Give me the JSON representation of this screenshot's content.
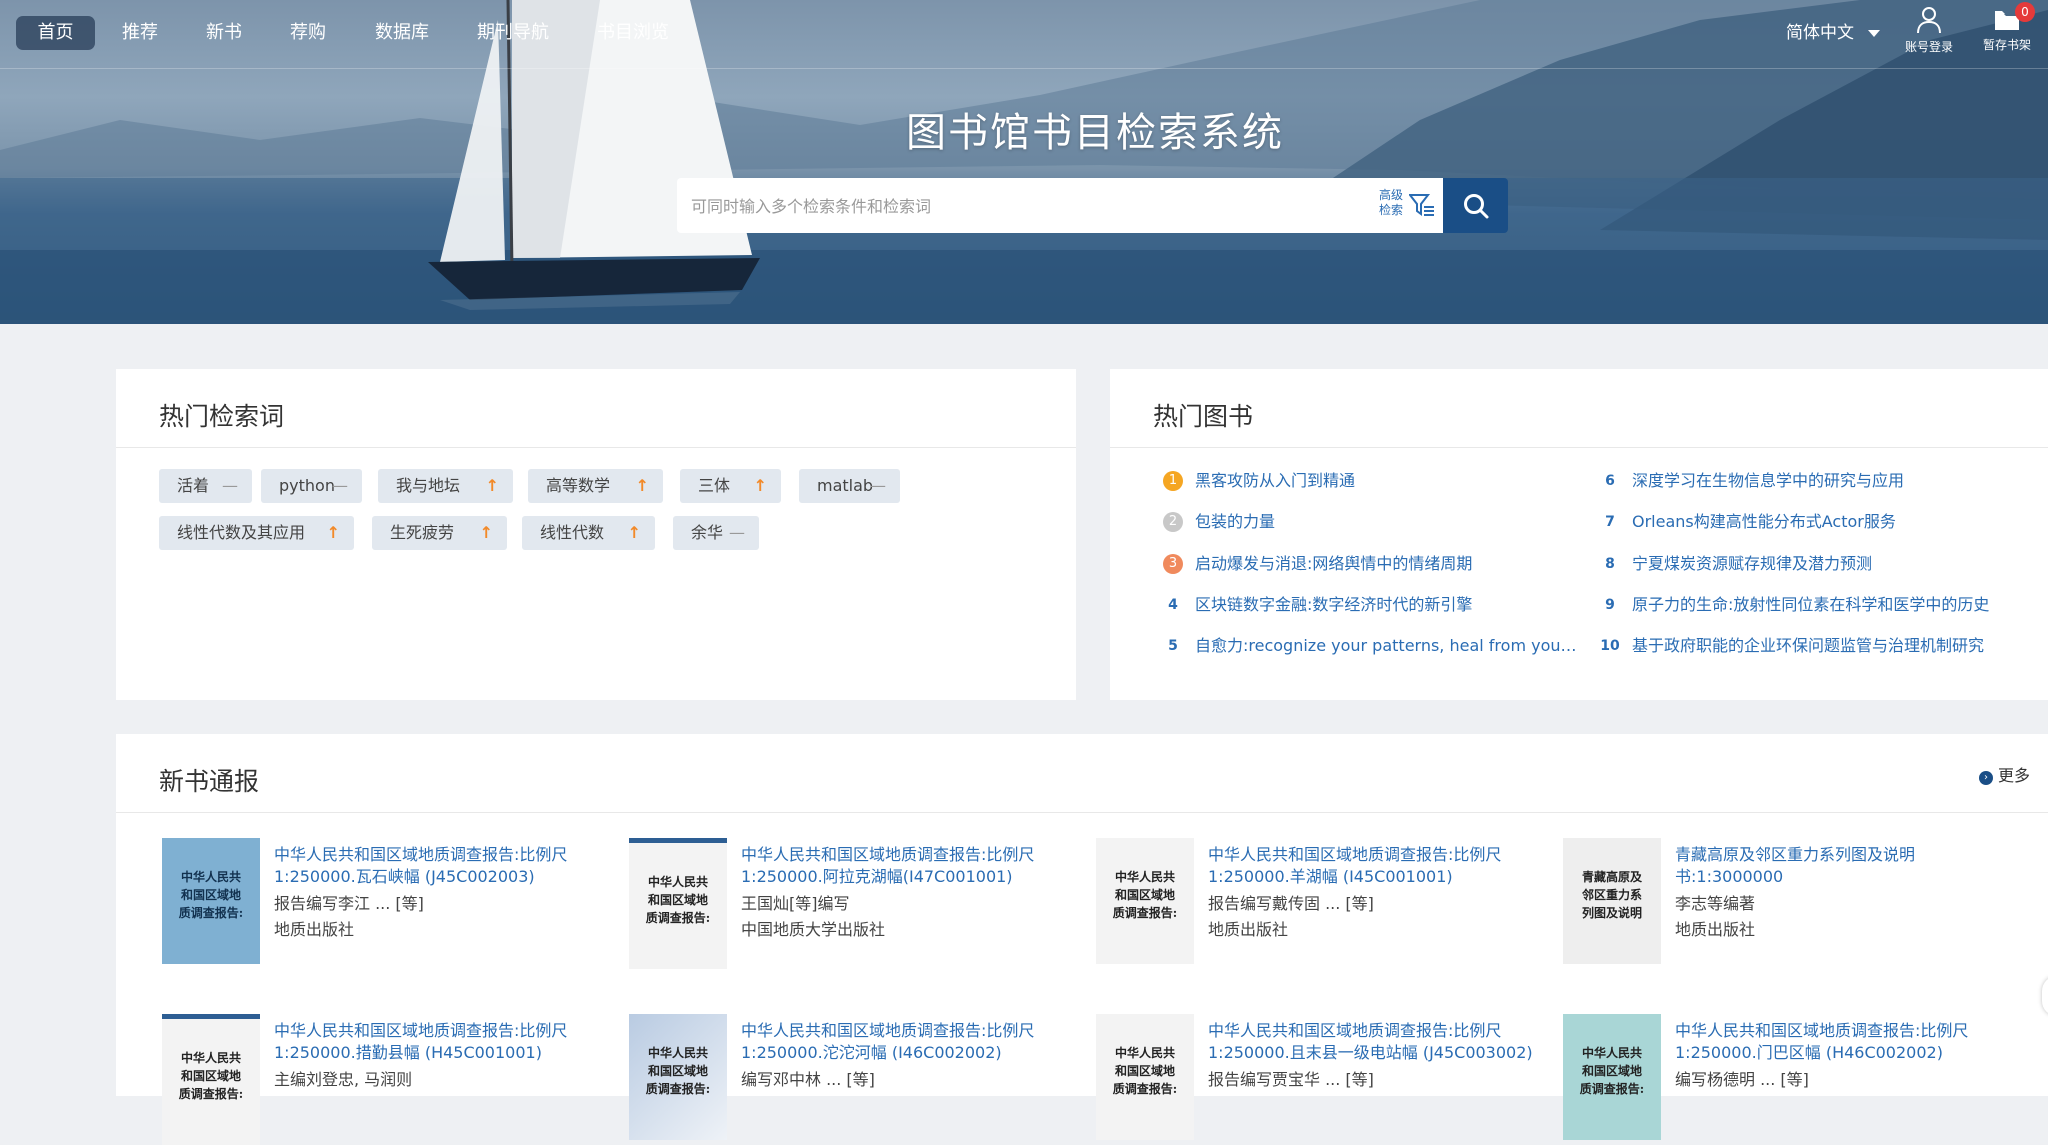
{
  "nav": {
    "items": [
      "首页",
      "推荐",
      "新书",
      "荐购",
      "数据库",
      "期刊导航",
      "书目浏览"
    ],
    "language": "简体中文",
    "account_label": "账号登录",
    "cart_label": "暂存书架",
    "cart_count": "0"
  },
  "hero": {
    "title": "图书馆书目检索系统",
    "search_placeholder": "可同时输入多个检索条件和检索词",
    "advanced_search_label": "高级检索"
  },
  "hot_terms": {
    "title": "热门检索词",
    "tags": [
      {
        "label": "活着",
        "trend": "flat"
      },
      {
        "label": "python",
        "trend": "flat"
      },
      {
        "label": "我与地坛",
        "trend": "up"
      },
      {
        "label": "高等数学",
        "trend": "up"
      },
      {
        "label": "三体",
        "trend": "up"
      },
      {
        "label": "matlab",
        "trend": "flat"
      },
      {
        "label": "线性代数及其应用",
        "trend": "up"
      },
      {
        "label": "生死疲劳",
        "trend": "up"
      },
      {
        "label": "线性代数",
        "trend": "up"
      },
      {
        "label": "余华",
        "trend": "flat"
      }
    ]
  },
  "hot_books": {
    "title": "热门图书",
    "items": [
      {
        "rank": "1",
        "title": "黑客攻防从入门到精通"
      },
      {
        "rank": "2",
        "title": "包装的力量"
      },
      {
        "rank": "3",
        "title": "启动爆发与消退:网络舆情中的情绪周期"
      },
      {
        "rank": "4",
        "title": "区块链数字金融:数字经济时代的新引擎"
      },
      {
        "rank": "5",
        "title": "自愈力:recognize your patterns, heal from your past, a..."
      },
      {
        "rank": "6",
        "title": "深度学习在生物信息学中的研究与应用"
      },
      {
        "rank": "7",
        "title": "Orleans构建高性能分布式Actor服务"
      },
      {
        "rank": "8",
        "title": "宁夏煤炭资源赋存规律及潜力预测"
      },
      {
        "rank": "9",
        "title": "原子力的生命:放射性同位素在科学和医学中的历史"
      },
      {
        "rank": "10",
        "title": "基于政府职能的企业环保问题监管与治理机制研究"
      }
    ]
  },
  "new_books": {
    "title": "新书通报",
    "more_label": "更多",
    "items": [
      {
        "title": "中华人民共和国区域地质调查报告:比例尺1:250000.瓦石峡幅 (J45C002003)",
        "author": "报告编写李江 ... [等]",
        "publisher": "地质出版社",
        "cover_text": "中华人民共\n和国区域地\n质调查报告:",
        "cover_color": "#7fb0d2"
      },
      {
        "title": "中华人民共和国区域地质调查报告:比例尺1:250000.阿拉克湖幅(I47C001001)",
        "author": "王国灿[等]编写",
        "publisher": "中国地质大学出版社",
        "cover_text": "中华人民共\n和国区域地\n质调查报告:",
        "cover_color": "#f2f2f2"
      },
      {
        "title": "中华人民共和国区域地质调查报告:比例尺1:250000.羊湖幅 (I45C001001)",
        "author": "报告编写戴传固 ... [等]",
        "publisher": "地质出版社",
        "cover_text": "中华人民共\n和国区域地\n质调查报告:",
        "cover_color": "#f4f4f4"
      },
      {
        "title": "青藏高原及邻区重力系列图及说明书:1:3000000",
        "author": "李志等编著",
        "publisher": "地质出版社",
        "cover_text": "青藏高原及\n邻区重力系\n列图及说明",
        "cover_color": "#eeeeee"
      },
      {
        "title": "中华人民共和国区域地质调查报告:比例尺1:250000.措勤县幅 (H45C001001)",
        "author": "主编刘登忠, 马润则",
        "publisher": "",
        "cover_text": "中华人民共\n和国区域地\n质调查报告:",
        "cover_color": "#f4f4f4"
      },
      {
        "title": "中华人民共和国区域地质调查报告:比例尺1:250000.沱沱河幅 (I46C002002)",
        "author": "编写邓中林 ... [等]",
        "publisher": "",
        "cover_text": "中华人民共\n和国区域地\n质调查报告:",
        "cover_color": "#dfe6f0"
      },
      {
        "title": "中华人民共和国区域地质调查报告:比例尺1:250000.且末县一级电站幅 (J45C003002)",
        "author": "报告编写贾宝华 ... [等]",
        "publisher": "",
        "cover_text": "中华人民共\n和国区域地\n质调查报告:",
        "cover_color": "#f4f4f4"
      },
      {
        "title": "中华人民共和国区域地质调查报告:比例尺1:250000.门巴区幅 (H46C002002)",
        "author": "编写杨德明 ... [等]",
        "publisher": "",
        "cover_text": "中华人民共\n和国区域地\n质调查报告:",
        "cover_color": "#a9d6d6"
      }
    ]
  },
  "colors": {
    "nav_active_bg": "#2e4560",
    "link_blue": "#2a6cb3",
    "search_button": "#1a4e86",
    "trend_up": "#f28a2a",
    "tag_bg": "#e2e8ef",
    "medal_gold": "#f5a623",
    "medal_silver": "#c8c8c8",
    "medal_bronze": "#f08a5d",
    "cart_badge": "#e53a3a"
  },
  "icons": {
    "account": "user-icon",
    "cart": "folder-icon",
    "search": "magnifier-icon",
    "advanced": "filter-icon",
    "more": "chevron-circle-icon"
  }
}
